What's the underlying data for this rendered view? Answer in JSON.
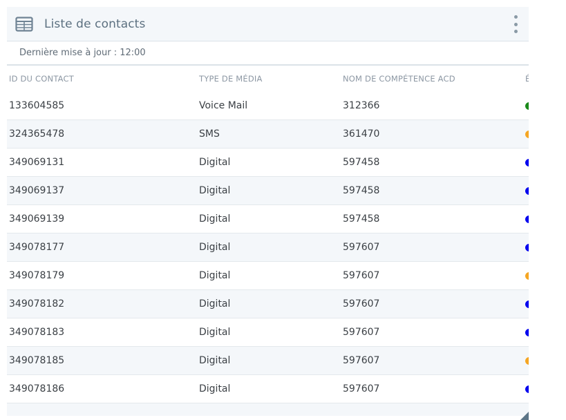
{
  "widget": {
    "title": "Liste de contacts",
    "icon": "table-icon",
    "menu_icon": "kebab-menu-icon",
    "last_update": "Dernière mise à jour : 12:00"
  },
  "table": {
    "columns": [
      "ID DU CONTACT",
      "TYPE DE MÉDIA",
      "NOM DE COMPÉTENCE ACD",
      "É"
    ],
    "rows": [
      {
        "id": "133604585",
        "media": "Voice Mail",
        "skill": "312366",
        "status_color": "#1a8a1a"
      },
      {
        "id": "324365478",
        "media": "SMS",
        "skill": "361470",
        "status_color": "#f5a623"
      },
      {
        "id": "349069131",
        "media": "Digital",
        "skill": "597458",
        "status_color": "#0000ee"
      },
      {
        "id": "349069137",
        "media": "Digital",
        "skill": "597458",
        "status_color": "#0000ee"
      },
      {
        "id": "349069139",
        "media": "Digital",
        "skill": "597458",
        "status_color": "#0000ee"
      },
      {
        "id": "349078177",
        "media": "Digital",
        "skill": "597607",
        "status_color": "#0000ee"
      },
      {
        "id": "349078179",
        "media": "Digital",
        "skill": "597607",
        "status_color": "#f5a623"
      },
      {
        "id": "349078182",
        "media": "Digital",
        "skill": "597607",
        "status_color": "#0000ee"
      },
      {
        "id": "349078183",
        "media": "Digital",
        "skill": "597607",
        "status_color": "#0000ee"
      },
      {
        "id": "349078185",
        "media": "Digital",
        "skill": "597607",
        "status_color": "#f5a623"
      },
      {
        "id": "349078186",
        "media": "Digital",
        "skill": "597607",
        "status_color": "#0000ee"
      }
    ]
  },
  "colors": {
    "status_green": "#1a8a1a",
    "status_orange": "#f5a623",
    "status_blue": "#0000ee",
    "header_bg": "#f4f7fa",
    "title_color": "#5c7080"
  }
}
